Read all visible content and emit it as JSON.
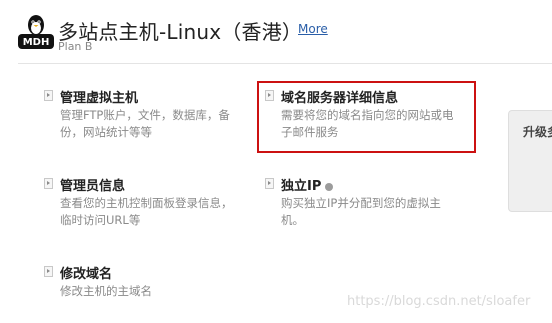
{
  "header": {
    "logo_text": "MDH",
    "title": "多站点主机-Linux（香港）",
    "more_link": "More",
    "subtitle": "Plan B"
  },
  "cards": [
    {
      "title": "管理虚拟主机",
      "desc_line1": "管理FTP账户，文件，数据库，备",
      "desc_line2": "份，网站统计等等"
    },
    {
      "title": "域名服务器详细信息",
      "desc_line1": "需要将您的域名指向您的网站或电",
      "desc_line2": "子邮件服务"
    },
    {
      "title": "管理员信息",
      "desc_line1": "查看您的主机控制面板登录信息，",
      "desc_line2": "临时访问URL等"
    },
    {
      "title": "独立IP",
      "desc_line1": "购买独立IP并分配到您的虚拟主",
      "desc_line2": "机。"
    },
    {
      "title": "修改域名",
      "desc_line1": "修改主机的主域名",
      "desc_line2": ""
    }
  ],
  "side_panel": {
    "label": "升级多"
  },
  "watermark": "https://blog.csdn.net/sloafer",
  "colors": {
    "highlight": "#cc1111",
    "link": "#2a5ea8"
  },
  "icons": [
    "penguin-logo-icon",
    "arrow-bullet-icon",
    "status-dot-icon"
  ]
}
